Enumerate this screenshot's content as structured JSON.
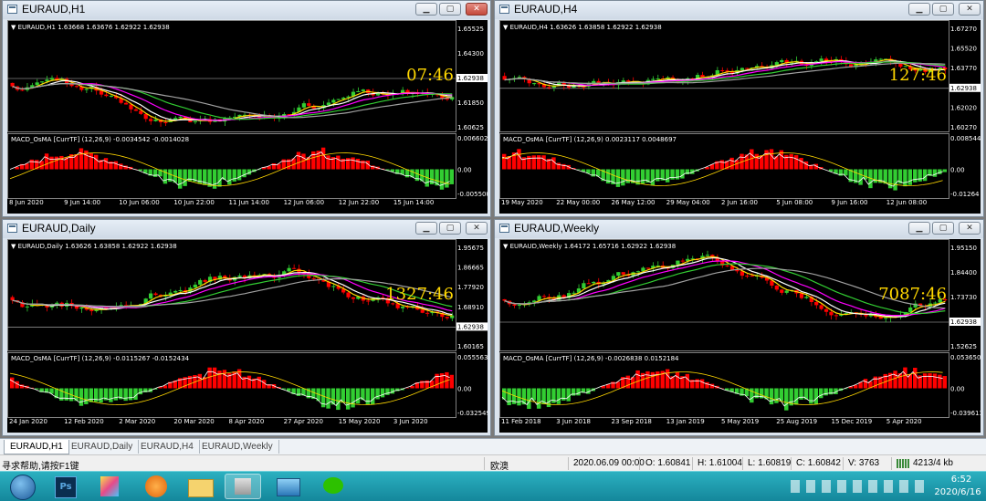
{
  "windows": [
    {
      "title": "EURAUD,H1",
      "header": "EURAUD,H1  1.63668 1.63676 1.62922 1.62938",
      "prices": [
        "1.65525",
        "1.64300",
        "1.62938",
        "1.61850",
        "1.60625"
      ],
      "timer": "07:46",
      "macd_label": "MACD_OsMA [CurrTF] (12,26,9) -0.0034542 -0.0014028",
      "macd_levels": [
        "0.0066027",
        "0.00",
        "-0.005500"
      ],
      "dates": [
        "8 Jun 2020",
        "9 Jun 14:00",
        "10 Jun 06:00",
        "10 Jun 22:00",
        "11 Jun 14:00",
        "12 Jun 06:00",
        "12 Jun 22:00",
        "15 Jun 14:00"
      ]
    },
    {
      "title": "EURAUD,H4",
      "header": "EURAUD,H4  1.63626 1.63858 1.62922 1.62938",
      "prices": [
        "1.67270",
        "1.65520",
        "1.63770",
        "1.62938",
        "1.62020",
        "1.60270"
      ],
      "timer": "127:46",
      "macd_label": "MACD_OsMA [CurrTF] (12,26,9) 0.0023117 0.0048697",
      "macd_levels": [
        "0.0085445",
        "0.00",
        "-0.01264"
      ],
      "dates": [
        "19 May 2020",
        "22 May 00:00",
        "26 May 12:00",
        "29 May 04:00",
        "2 Jun 16:00",
        "5 Jun 08:00",
        "9 Jun 16:00",
        "12 Jun 08:00"
      ]
    },
    {
      "title": "EURAUD,Daily",
      "header": "EURAUD,Daily  1.63626 1.63858 1.62922 1.62938",
      "prices": [
        "1.95675",
        "1.86665",
        "1.77920",
        "1.68910",
        "1.62938",
        "1.60165"
      ],
      "timer": "1327:46",
      "macd_label": "MACD_OsMA [CurrTF] (12,26,9) -0.0115267 -0.0152434",
      "macd_levels": [
        "0.0555631",
        "0.00",
        "-0.032549"
      ],
      "dates": [
        "24 Jan 2020",
        "12 Feb 2020",
        "2 Mar 2020",
        "20 Mar 2020",
        "8 Apr 2020",
        "27 Apr 2020",
        "15 May 2020",
        "3 Jun 2020"
      ]
    },
    {
      "title": "EURAUD,Weekly",
      "header": "EURAUD,Weekly  1.64172 1.65716 1.62922 1.62938",
      "prices": [
        "1.95150",
        "1.84400",
        "1.73730",
        "1.62938",
        "1.52625"
      ],
      "timer": "7087:46",
      "macd_label": "MACD_OsMA [CurrTF] (12,26,9) -0.0026838 0.0152184",
      "macd_levels": [
        "0.0536509",
        "0.00",
        "-0.039613"
      ],
      "dates": [
        "11 Feb 2018",
        "3 Jun 2018",
        "23 Sep 2018",
        "13 Jan 2019",
        "5 May 2019",
        "25 Aug 2019",
        "15 Dec 2019",
        "5 Apr 2020"
      ]
    }
  ],
  "tabs": [
    "EURAUD,H1",
    "EURAUD,Daily",
    "EURAUD,H4",
    "EURAUD,Weekly"
  ],
  "status": {
    "help": "寻求帮助,请按F1键",
    "profile": "欧澳",
    "datetime": "2020.06.09 00:00",
    "open": "O: 1.60841",
    "high": "H: 1.61004",
    "low": "L: 1.60819",
    "close": "C: 1.60842",
    "volume": "V: 3763",
    "traffic": "4213/4 kb"
  },
  "taskbar": {
    "clock_time": "6:52",
    "clock_date": "2020/6/16",
    "apps": [
      "start-orb",
      "photoshop",
      "paint",
      "media",
      "explorer",
      "metatrader",
      "photo-viewer",
      "wechat"
    ]
  },
  "colors": {
    "bull_candle": "#32cd32",
    "bear_candle": "#ff0000",
    "ma_yellow": "#ffd700",
    "ma_white": "#ffffff",
    "ma_magenta": "#ff00ff",
    "ma_green": "#32cd32",
    "ma_gray": "#a0a0a0",
    "timer": "#ffd700"
  }
}
